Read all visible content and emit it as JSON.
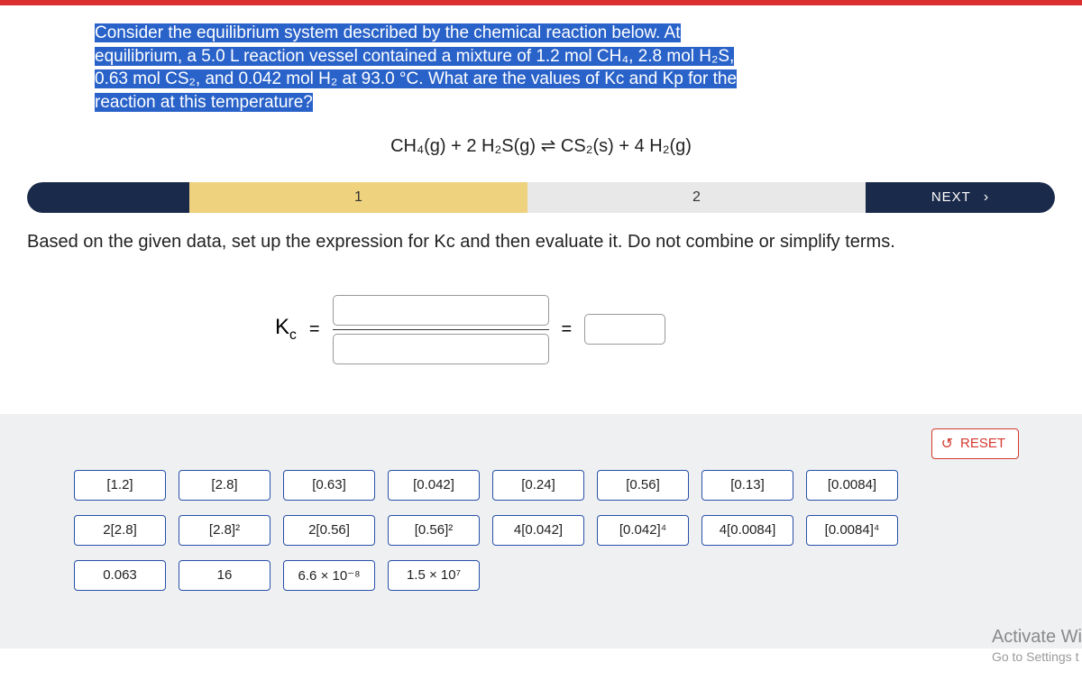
{
  "question": {
    "line1": "Consider the equilibrium system described by the chemical reaction below. At",
    "line2": "equilibrium, a 5.0 L reaction vessel contained a mixture of 1.2 mol CH₄, 2.8 mol H₂S,",
    "line3": "0.63 mol CS₂, and 0.042 mol H₂ at 93.0 °C. What are the values of Kc and Kp for the",
    "line4": "reaction at this temperature?"
  },
  "equation": "CH₄(g) + 2 H₂S(g) ⇌ CS₂(s) + 4 H₂(g)",
  "steps": {
    "s1": "1",
    "s2": "2",
    "next": "NEXT"
  },
  "instruction": "Based on the given data, set up the expression for Kc and then evaluate it. Do not combine or simplify terms.",
  "expr": {
    "kc_html": "K",
    "kc_sub": "c",
    "equals": "="
  },
  "reset": "RESET",
  "tiles": [
    {
      "label": "[1.2]"
    },
    {
      "label": "[2.8]"
    },
    {
      "label": "[0.63]"
    },
    {
      "label": "[0.042]"
    },
    {
      "label": "[0.24]"
    },
    {
      "label": "[0.56]"
    },
    {
      "label": "[0.13]"
    },
    {
      "label": "[0.0084]"
    },
    {
      "label": "2[2.8]"
    },
    {
      "label": "[2.8]²"
    },
    {
      "label": "2[0.56]"
    },
    {
      "label": "[0.56]²"
    },
    {
      "label": "4[0.042]"
    },
    {
      "label": "[0.042]⁴"
    },
    {
      "label": "4[0.0084]"
    },
    {
      "label": "[0.0084]⁴"
    },
    {
      "label": "0.063"
    },
    {
      "label": "16"
    },
    {
      "label": "6.6 × 10⁻⁸"
    },
    {
      "label": "1.5 × 10⁷"
    }
  ],
  "watermark": {
    "w1": "Activate Wi",
    "w2": "Go to Settings t"
  }
}
